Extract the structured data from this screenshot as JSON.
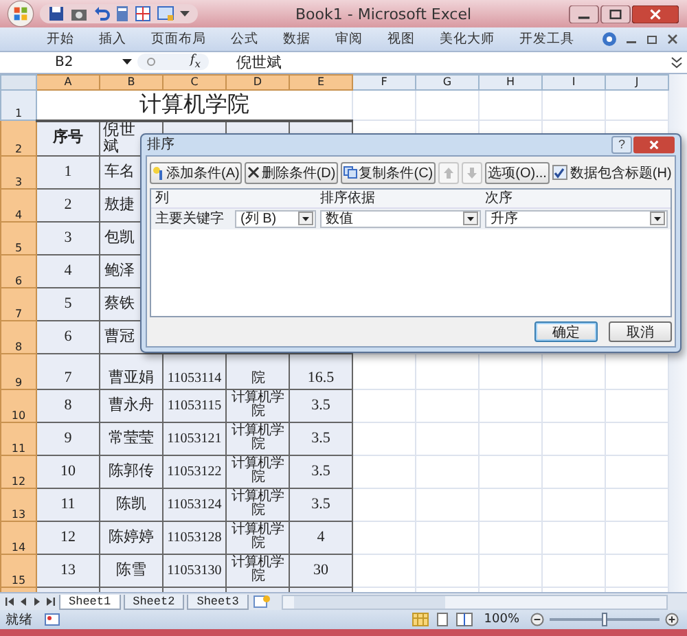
{
  "window": {
    "title": "Book1 - Microsoft Excel"
  },
  "ribbon_tabs": [
    "开始",
    "插入",
    "页面布局",
    "公式",
    "数据",
    "审阅",
    "视图",
    "美化大师",
    "开发工具"
  ],
  "formula_bar": {
    "name_box": "B2",
    "fx_label": "f$_{x}$",
    "value": "倪世斌"
  },
  "columns": [
    {
      "label": "A",
      "selected": true
    },
    {
      "label": "B",
      "selected": true
    },
    {
      "label": "C",
      "selected": true
    },
    {
      "label": "D",
      "selected": true
    },
    {
      "label": "E",
      "selected": true
    },
    {
      "label": "F",
      "selected": false
    },
    {
      "label": "G",
      "selected": false
    },
    {
      "label": "H",
      "selected": false
    },
    {
      "label": "I",
      "selected": false
    },
    {
      "label": "J",
      "selected": false
    }
  ],
  "sheet_title": "计算机学院",
  "rows": [
    {
      "header": "1",
      "selected": false,
      "kind": "title"
    },
    {
      "header": "2",
      "selected": true,
      "kind": "head",
      "cells": [
        "序号",
        "倪世斌",
        null,
        null,
        null
      ]
    },
    {
      "header": "3",
      "selected": true,
      "kind": "covered",
      "cells": [
        "1",
        "车名",
        null,
        null,
        null
      ]
    },
    {
      "header": "4",
      "selected": true,
      "kind": "covered",
      "cells": [
        "2",
        "敖捷",
        null,
        null,
        null
      ]
    },
    {
      "header": "5",
      "selected": true,
      "kind": "covered",
      "cells": [
        "3",
        "包凯",
        null,
        null,
        null
      ]
    },
    {
      "header": "6",
      "selected": true,
      "kind": "covered",
      "cells": [
        "4",
        "鲍泽",
        null,
        null,
        null
      ]
    },
    {
      "header": "7",
      "selected": true,
      "kind": "covered",
      "cells": [
        "5",
        "蔡铁",
        null,
        null,
        null
      ]
    },
    {
      "header": "8",
      "selected": true,
      "kind": "covered",
      "cells": [
        "6",
        "曹冠",
        null,
        null,
        null
      ]
    },
    {
      "header": "9",
      "selected": true,
      "kind": "partial",
      "cells": [
        "7",
        "曹亚娟",
        "11053114",
        "院",
        "16.5"
      ]
    },
    {
      "header": "10",
      "selected": true,
      "kind": "data",
      "cells": [
        "8",
        "曹永舟",
        "11053115",
        "计算机学院",
        "3.5"
      ]
    },
    {
      "header": "11",
      "selected": true,
      "kind": "data",
      "cells": [
        "9",
        "常莹莹",
        "11053121",
        "计算机学院",
        "3.5"
      ]
    },
    {
      "header": "12",
      "selected": true,
      "kind": "data",
      "cells": [
        "10",
        "陈郭传",
        "11053122",
        "计算机学院",
        "3.5"
      ]
    },
    {
      "header": "13",
      "selected": true,
      "kind": "data",
      "cells": [
        "11",
        "陈凯",
        "11053124",
        "计算机学院",
        "3.5"
      ]
    },
    {
      "header": "14",
      "selected": true,
      "kind": "data",
      "cells": [
        "12",
        "陈婷婷",
        "11053128",
        "计算机学院",
        "4"
      ]
    },
    {
      "header": "15",
      "selected": true,
      "kind": "data",
      "cells": [
        "13",
        "陈雪",
        "11053130",
        "计算机学院",
        "30"
      ]
    }
  ],
  "sheet_tabs": [
    {
      "label": "Sheet1",
      "selected": true
    },
    {
      "label": "Sheet2",
      "selected": false
    },
    {
      "label": "Sheet3",
      "selected": false
    }
  ],
  "status_bar": {
    "status": "就绪",
    "zoom": "100%",
    "zoom_slider": {
      "level": 0.5
    }
  },
  "dialog": {
    "title": "排序",
    "help": "?",
    "toolbar": [
      {
        "kind": "add",
        "label": "添加条件(A)"
      },
      {
        "kind": "delete",
        "label": "删除条件(D)"
      },
      {
        "kind": "copy",
        "label": "复制条件(C)"
      },
      {
        "kind": "up",
        "disabled": true
      },
      {
        "kind": "down",
        "disabled": true
      },
      {
        "kind": "text",
        "label": "选项(O)..."
      }
    ],
    "header_checkbox": {
      "label": "数据包含标题(H)",
      "checked": true
    },
    "list_headers": [
      "列",
      "排序依据",
      "次序"
    ],
    "levels": [
      {
        "label": "主要关键字",
        "column": "(列 B)",
        "sort_on": "数值",
        "order": "升序"
      }
    ],
    "buttons": [
      {
        "label": "确定",
        "default": true
      },
      {
        "label": "取消",
        "default": false
      }
    ]
  }
}
